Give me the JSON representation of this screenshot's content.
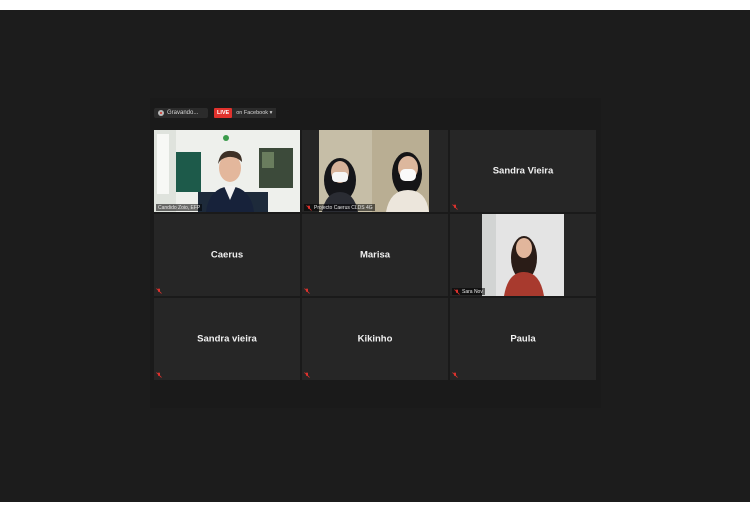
{
  "toolbar": {
    "recording_label": "Gravando...",
    "live_badge": "LIVE",
    "live_target": "on Facebook"
  },
  "participants": [
    {
      "display": "Candido Zoio, EFP",
      "video": true
    },
    {
      "display": "Projecto Caerus CLDS 4G",
      "video": true
    },
    {
      "display": "Sandra Vieira",
      "video": false
    },
    {
      "display": "Caerus",
      "video": false
    },
    {
      "display": "Marisa",
      "video": false
    },
    {
      "display": "Sara Nov",
      "video": true
    },
    {
      "display": "Sandra vieira",
      "video": false
    },
    {
      "display": "Kikinho",
      "video": false
    },
    {
      "display": "Paula",
      "video": false
    }
  ],
  "colors": {
    "live": "#e0322d",
    "active_speaker": "#c8e05a",
    "muted_mic": "#e0322d"
  }
}
